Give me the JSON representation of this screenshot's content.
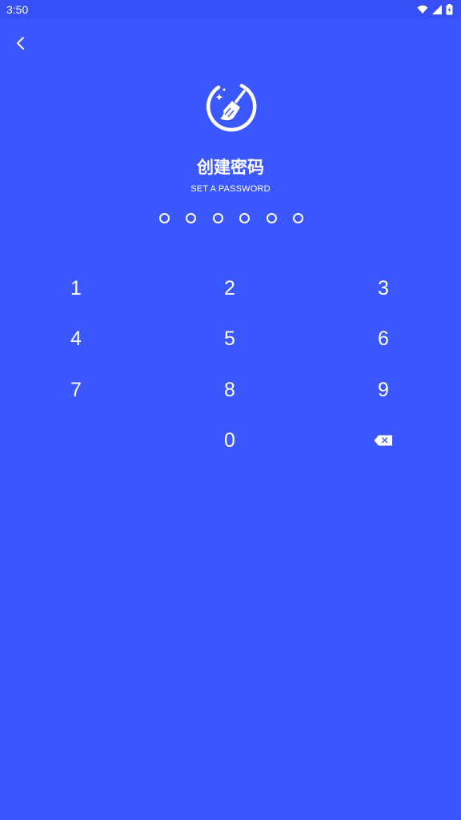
{
  "status_bar": {
    "time": "3:50",
    "icons": [
      "wifi-icon",
      "signal-icon",
      "battery-icon"
    ]
  },
  "header": {
    "back_icon": "chevron-left-icon"
  },
  "logo": {
    "icon": "broom-cleaner-icon"
  },
  "title": "创建密码",
  "subtitle": "SET A PASSWORD",
  "pin": {
    "length": 6,
    "filled": 0
  },
  "keypad": {
    "keys": [
      "1",
      "2",
      "3",
      "4",
      "5",
      "6",
      "7",
      "8",
      "9",
      "0"
    ],
    "delete_icon": "backspace-icon"
  },
  "colors": {
    "background": "#3B57FF",
    "status_bar": "#3650F5",
    "foreground": "#FFFFFF"
  }
}
